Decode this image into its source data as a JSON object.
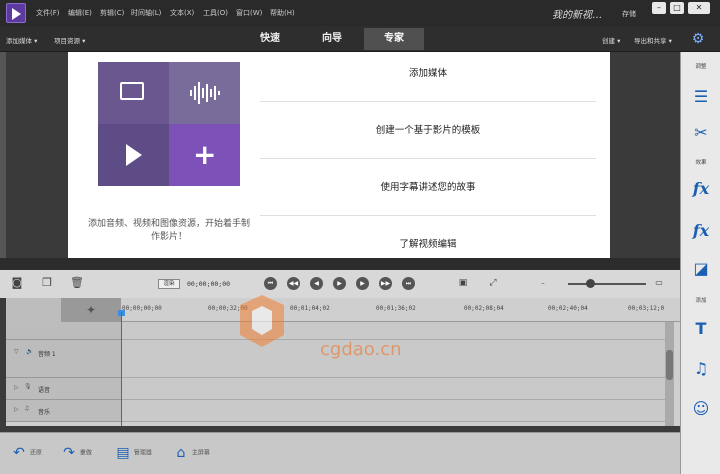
{
  "menu": [
    "文件(F)",
    "编辑(E)",
    "剪辑(C)",
    "时间轴(L)",
    "文本(X)",
    "工具(O)",
    "窗口(W)",
    "帮助(H)"
  ],
  "project_title": "我的新视…",
  "save_label": "存储",
  "window_buttons": [
    "–",
    "□",
    "✕"
  ],
  "toolbar": {
    "add_media": "添加媒体",
    "project_assets": "项目资源",
    "create": "创建",
    "export_share": "导出和共享"
  },
  "tabs": [
    "快速",
    "向导",
    "专家"
  ],
  "welcome": {
    "caption": "添加音频、视频和图像资源，开始着手制作影片！",
    "options": [
      "添加媒体",
      "创建一个基于影片的模板",
      "使用字幕讲述您的故事",
      "了解视频编辑"
    ]
  },
  "right_panel": {
    "adjust": "调整",
    "effects": "效果",
    "add": "添加"
  },
  "timeline": {
    "tc_label": "渲染",
    "timecode": "00;00;00;00",
    "ruler": [
      "00;00;00;00",
      "00;00;32;00",
      "00;01;04;02",
      "00;01;36;02",
      "00;02;08;04",
      "00;02;40;04",
      "00;03;12;0"
    ],
    "tracks": [
      {
        "name": "音频 1"
      },
      {
        "name": "语音"
      },
      {
        "name": "音乐"
      }
    ]
  },
  "bottom": {
    "undo": "还原",
    "redo": "重做",
    "organizer": "管理器",
    "home": "主屏幕"
  },
  "watermark": "cgdao.cn",
  "colors": {
    "accent": "#7d52b8",
    "blue": "#1b5fb3",
    "playhead": "#e03030"
  }
}
